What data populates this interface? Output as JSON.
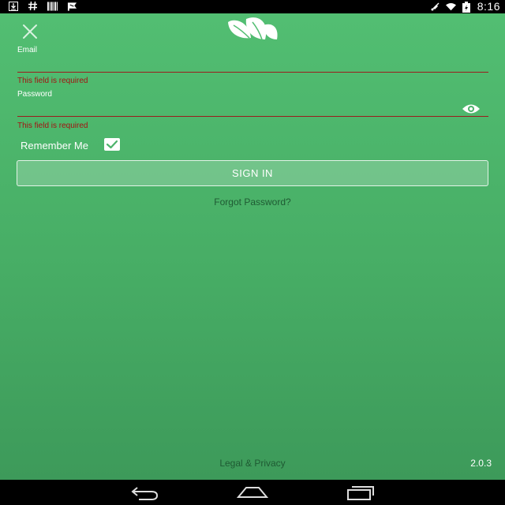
{
  "status_bar": {
    "left_icons": [
      "download-icon",
      "hash-icon",
      "barcode-icon",
      "flag-icon"
    ],
    "right_icons": [
      "mute-icon",
      "wifi-icon",
      "battery-icon"
    ],
    "time": "8:16"
  },
  "header": {
    "close_icon": "close-icon",
    "logo": "leaf-logo"
  },
  "form": {
    "email_label": "Email",
    "email_value": "",
    "email_error": "This field is required",
    "password_label": "Password",
    "password_value": "",
    "password_error": "This field is required",
    "show_password_icon": "eye-icon",
    "remember_label": "Remember Me",
    "remember_checked": true,
    "signin_label": "SIGN IN",
    "forgot_label": "Forgot Password?"
  },
  "footer": {
    "legal_label": "Legal & Privacy",
    "version": "2.0.3"
  },
  "nav_bar": {
    "buttons": [
      "back-icon",
      "home-icon",
      "recents-icon"
    ]
  },
  "colors": {
    "background_top": "#52be72",
    "background_bottom": "#3d9a5a",
    "error": "#a41212",
    "link": "#1f5a33"
  }
}
